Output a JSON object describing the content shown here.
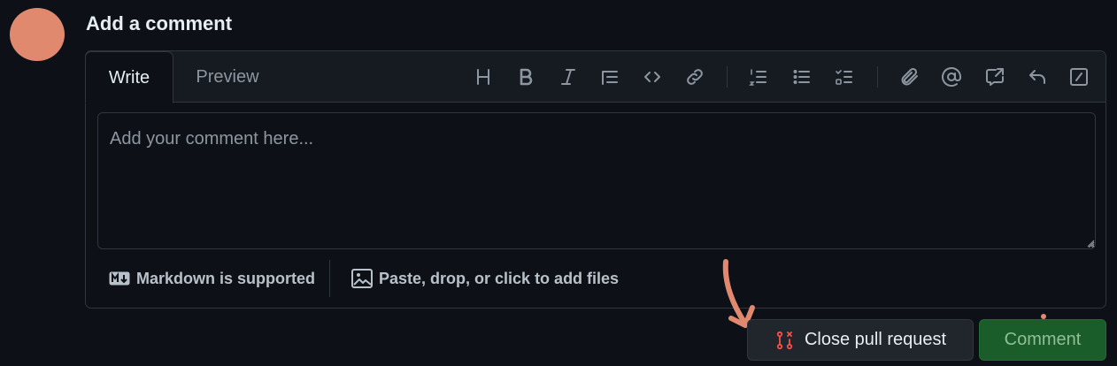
{
  "heading": "Add a comment",
  "tabs": {
    "write": "Write",
    "preview": "Preview"
  },
  "toolbar": [
    {
      "name": "heading-icon"
    },
    {
      "name": "bold-icon"
    },
    {
      "name": "italic-icon"
    },
    {
      "name": "quote-icon"
    },
    {
      "name": "code-icon"
    },
    {
      "name": "link-icon"
    },
    {
      "name": "numbered-list-icon"
    },
    {
      "name": "unordered-list-icon"
    },
    {
      "name": "task-list-icon"
    },
    {
      "name": "attach-icon"
    },
    {
      "name": "mention-icon"
    },
    {
      "name": "cross-reference-icon"
    },
    {
      "name": "reply-icon"
    },
    {
      "name": "slash-commands-icon"
    }
  ],
  "textarea": {
    "placeholder": "Add your comment here...",
    "value": ""
  },
  "footer": {
    "markdown": "Markdown is supported",
    "files": "Paste, drop, or click to add files"
  },
  "buttons": {
    "close": "Close pull request",
    "comment": "Comment"
  },
  "colors": {
    "background": "#0d1117",
    "avatar": "#e0896f",
    "danger_icon": "#f85149",
    "comment_button": "#1a5c2a",
    "annotation": "#e0896f"
  }
}
